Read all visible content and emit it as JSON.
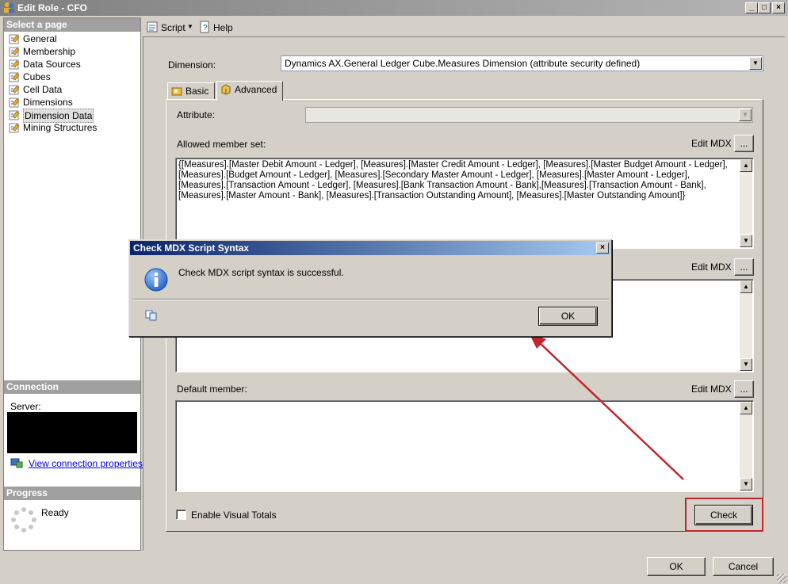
{
  "window": {
    "title": "Edit Role - CFO",
    "minimize_label": "_",
    "maximize_label": "□",
    "close_label": "×"
  },
  "sidebar": {
    "header": "Select a page",
    "items": [
      {
        "label": "General"
      },
      {
        "label": "Membership"
      },
      {
        "label": "Data Sources"
      },
      {
        "label": "Cubes"
      },
      {
        "label": "Cell Data"
      },
      {
        "label": "Dimensions"
      },
      {
        "label": "Dimension Data",
        "selected": true
      },
      {
        "label": "Mining Structures"
      }
    ],
    "connection": {
      "header": "Connection",
      "server_label": "Server:",
      "link": "View connection properties"
    },
    "progress": {
      "header": "Progress",
      "status": "Ready"
    }
  },
  "toolbar": {
    "script_label": "Script",
    "help_label": "Help"
  },
  "main": {
    "dimension_label": "Dimension:",
    "dimension_value": "Dynamics AX.General Ledger Cube.Measures Dimension (attribute security defined)",
    "tabs": [
      {
        "label": "Basic"
      },
      {
        "label": "Advanced",
        "active": true
      }
    ],
    "attribute_label": "Attribute:",
    "attribute_value": "",
    "allowed_label": "Allowed member set:",
    "edit_mdx_label": "Edit MDX",
    "ellipsis": "...",
    "allowed_text": "{[Measures].[Master Debit Amount - Ledger], [Measures].[Master Credit Amount - Ledger], [Measures].[Master Budget Amount - Ledger], [Measures].[Budget Amount - Ledger], [Measures].[Secondary Master Amount - Ledger], [Measures].[Master Amount - Ledger], [Measures].[Transaction Amount - Ledger], [Measures].[Bank Transaction Amount - Bank],[Measures].[Transaction Amount - Bank], [Measures].[Master Amount - Bank], [Measures].[Transaction Outstanding Amount], [Measures].[Master Outstanding Amount]}",
    "default_member_label": "Default member:",
    "visual_totals_label": "Enable Visual Totals",
    "check_label": "Check"
  },
  "footer": {
    "ok_label": "OK",
    "cancel_label": "Cancel"
  },
  "dialog": {
    "title": "Check MDX Script Syntax",
    "message": "Check MDX script syntax is successful.",
    "ok_label": "OK",
    "close_label": "×"
  },
  "colors": {
    "annotation_red": "#c0262a",
    "dialog_title_blue": "#0a246a",
    "info_icon_blue": "#1c5cc6"
  }
}
